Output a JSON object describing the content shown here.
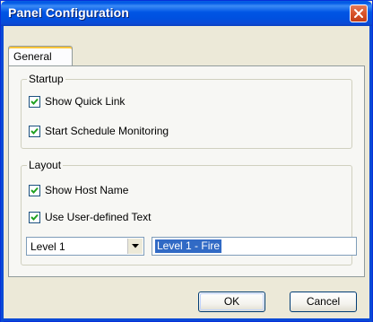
{
  "window": {
    "title": "Panel Configuration"
  },
  "tabs": [
    {
      "label": "General",
      "selected": true
    }
  ],
  "groups": {
    "startup": {
      "legend": "Startup",
      "options": [
        {
          "label": "Show Quick Link",
          "checked": true
        },
        {
          "label": "Start Schedule Monitoring",
          "checked": true
        }
      ]
    },
    "layout": {
      "legend": "Layout",
      "options": [
        {
          "label": "Show Host Name",
          "checked": true
        },
        {
          "label": "Use User-defined Text",
          "checked": true
        }
      ],
      "level_select": {
        "value": "Level 1"
      },
      "custom_text": {
        "value": "Level 1 - Fire"
      }
    }
  },
  "buttons": {
    "ok": "OK",
    "cancel": "Cancel"
  },
  "icons": {
    "close": "close-icon",
    "checkmark": "check-icon",
    "dropdown": "chevron-down-icon"
  },
  "colors": {
    "titlebar": "#0055e5",
    "selection": "#316ac5",
    "close_button": "#d8542a",
    "tab_highlight": "#ffc73c"
  }
}
